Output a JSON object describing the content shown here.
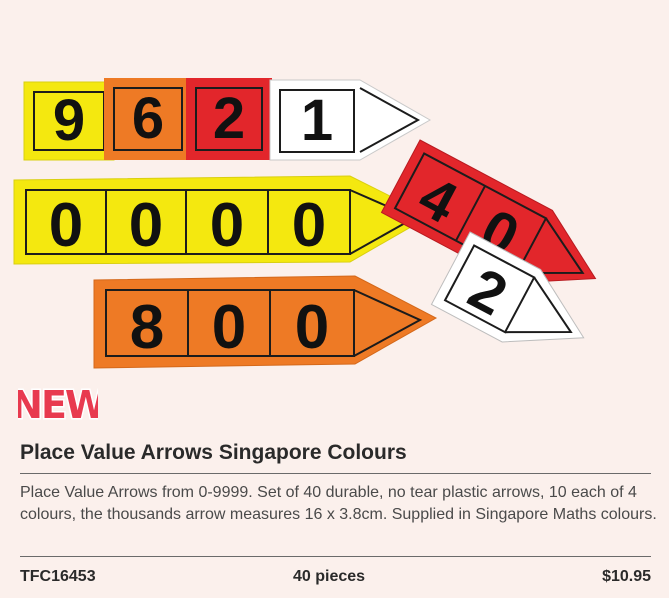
{
  "product": {
    "badge": "NEW",
    "title": "Place Value Arrows Singapore Colours",
    "description": "Place Value Arrows from 0-9999. Set of 40 durable, no tear plastic arrows, 10 each of 4 colours, the thousands arrow measures 16 x 3.8cm. Supplied in Singapore Maths colours.",
    "code": "TFC16453",
    "quantity": "40 pieces",
    "price": "$10.95"
  },
  "photo": {
    "arrow_numbers": {
      "thousands": [
        "9",
        "6",
        "2",
        "1"
      ],
      "thousands_zero": [
        "0",
        "0",
        "0",
        "0"
      ],
      "hundreds": [
        "8",
        "0",
        "0"
      ],
      "tens": [
        "4",
        "0"
      ],
      "ones": [
        "2"
      ]
    },
    "colors": {
      "thousands": "#f4e80f",
      "hundreds": "#ee7a25",
      "tens": "#e2262b",
      "ones": "#ffffff",
      "badge": "#e83a4f"
    }
  }
}
